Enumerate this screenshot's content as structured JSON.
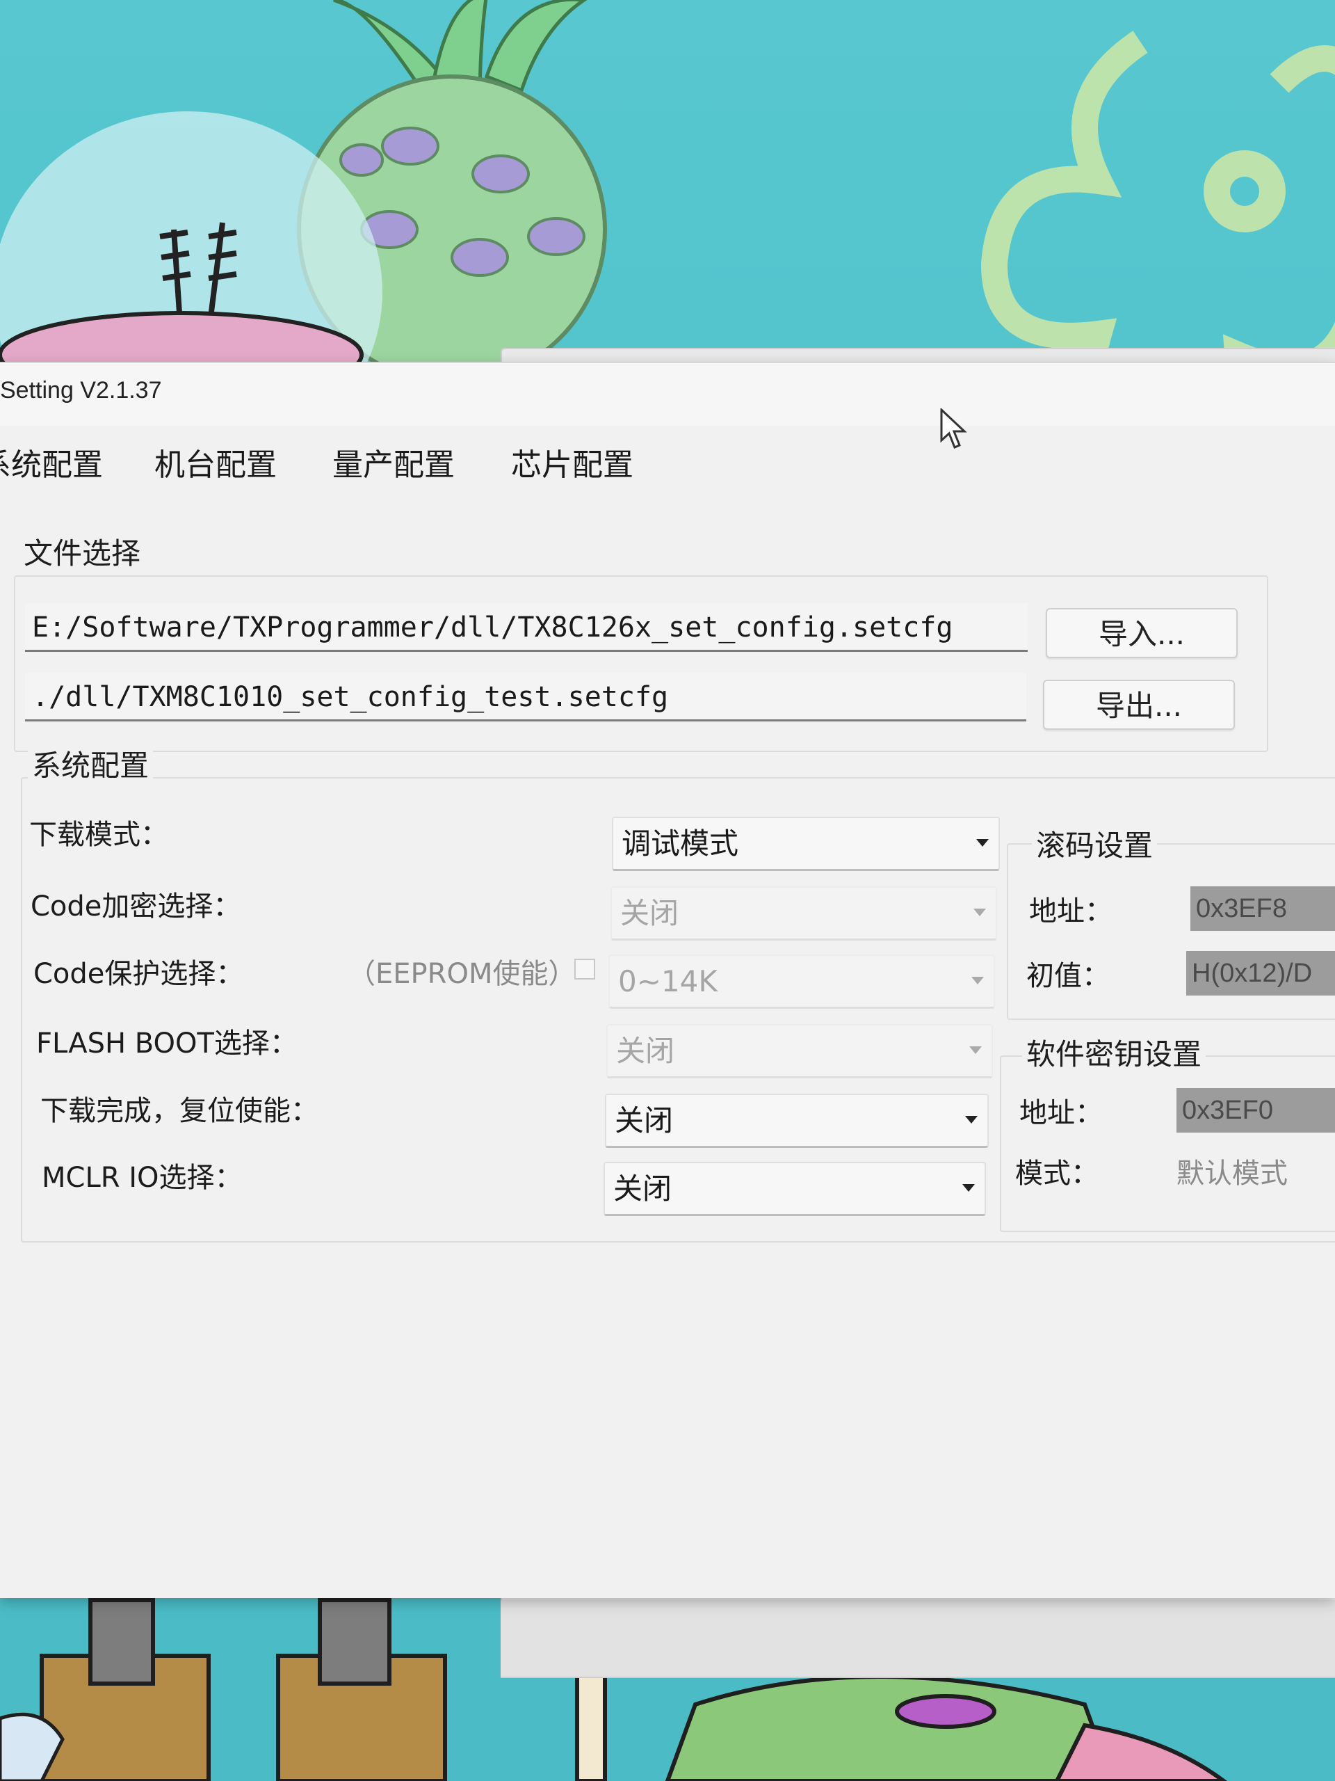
{
  "window": {
    "title": "Setting  V2.1.37"
  },
  "menu": {
    "items": [
      "系统配置",
      "机台配置",
      "量产配置",
      "芯片配置"
    ]
  },
  "file_section": {
    "title": "文件选择",
    "import_path": "E:/Software/TXProgrammer/dll/TX8C126x_set_config.setcfg",
    "export_path": "./dll/TXM8C1010_set_config_test.setcfg",
    "import_button": "导入...",
    "export_button": "导出..."
  },
  "system_section": {
    "title": "系统配置",
    "download_mode_label": "下载模式：",
    "download_mode_value": "调试模式",
    "code_encrypt_label": "Code加密选择：",
    "code_encrypt_value": "关闭",
    "code_protect_label": "Code保护选择：",
    "eeprom_label": "（EEPROM使能）",
    "code_protect_value": "0~14K",
    "flash_boot_label": "FLASH BOOT选择：",
    "flash_boot_value": "关闭",
    "reset_enable_label": "下载完成，复位使能：",
    "reset_enable_value": "关闭",
    "mclr_label": "MCLR IO选择：",
    "mclr_value": "关闭"
  },
  "rolling_code": {
    "title": "滚码设置",
    "address_label": "地址：",
    "address_value": "0x3EF8",
    "initial_label": "初值：",
    "initial_value": "H(0x12)/D"
  },
  "software_key": {
    "title": "软件密钥设置",
    "address_label": "地址：",
    "address_value": "0x3EF0",
    "mode_label": "模式：",
    "mode_value": "默认模式"
  }
}
